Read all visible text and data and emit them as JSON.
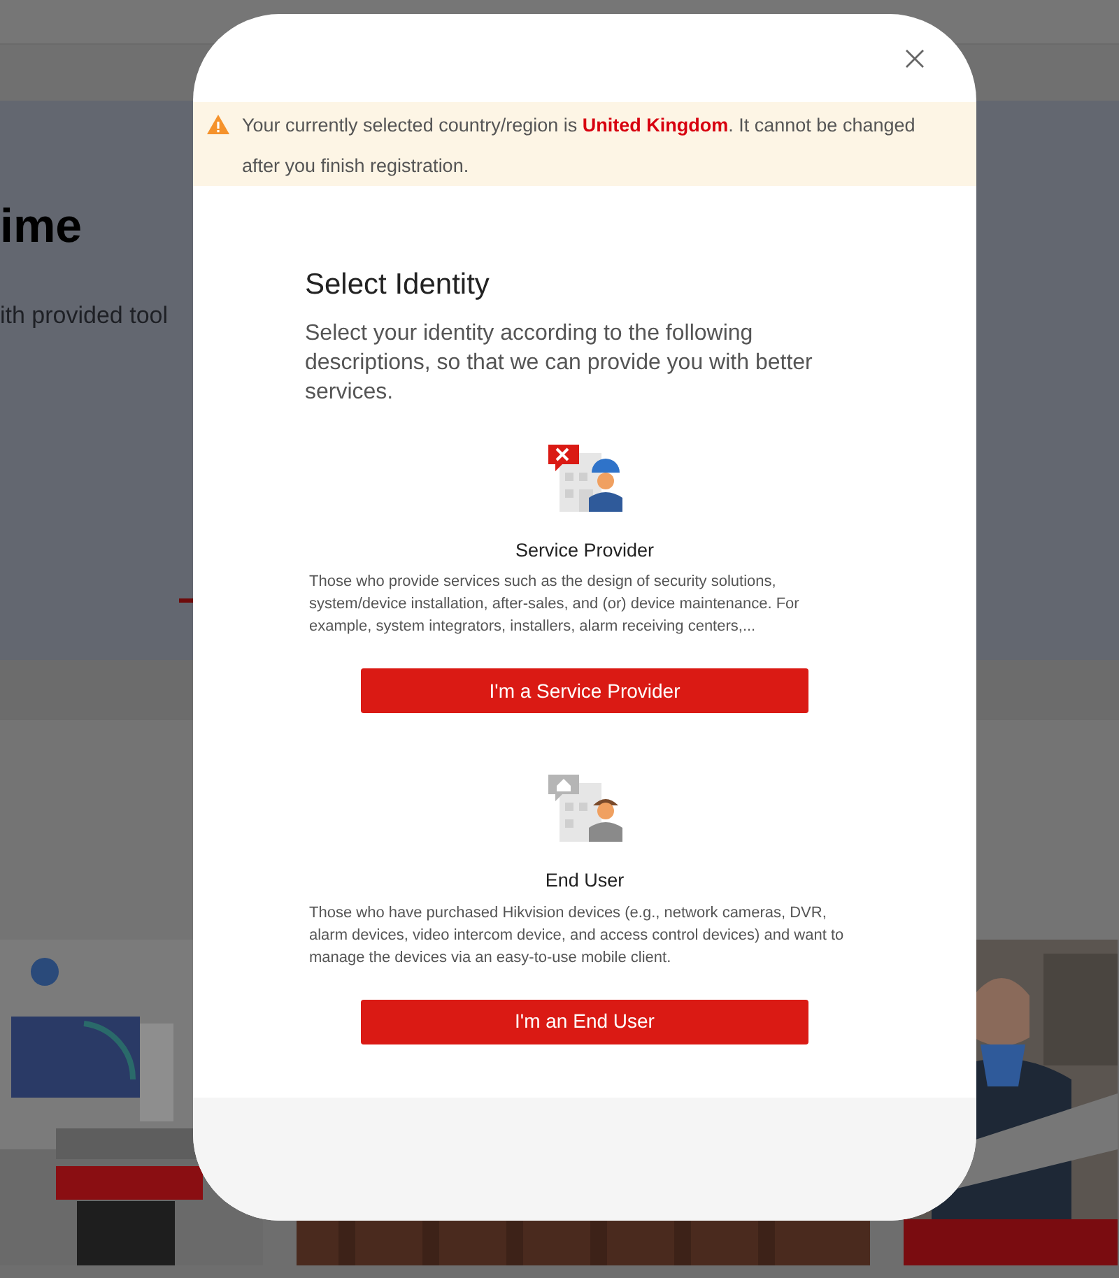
{
  "background": {
    "heading": "ime",
    "subtitle": "ith provided tool"
  },
  "dialog": {
    "notice": "Your currently selected country/region is **United Kingdom**. It cannot be changed after you finish registration.",
    "title": "Select Identity",
    "intro": "Select your identity according to the following descriptions, so that we can provide you with better services.",
    "options": [
      {
        "kind": "service-provider",
        "title": "Service Provider",
        "description": "Those who provide services such as the design of security solutions, system/device installation, after-sales, and (or) device maintenance. For example, system integrators, installers, alarm receiving centers,...",
        "button": "I'm a Service Provider"
      },
      {
        "kind": "end-user",
        "title": "End User",
        "description": "Those who have purchased Hikvision devices (e.g., network cameras, DVR, alarm devices, video intercom device, and access control devices) and want to manage the devices via an easy-to-use mobile client.",
        "button": "I'm an End User"
      }
    ]
  }
}
